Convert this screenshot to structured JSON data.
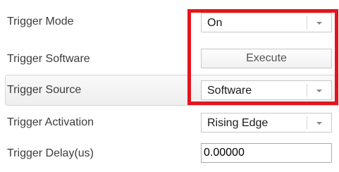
{
  "properties": [
    {
      "label": "Trigger Mode",
      "type": "dropdown",
      "value": "On"
    },
    {
      "label": "Trigger Software",
      "type": "button",
      "value": "Execute"
    },
    {
      "label": "Trigger Source",
      "type": "dropdown",
      "value": "Software"
    },
    {
      "label": "Trigger Activation",
      "type": "dropdown",
      "value": "Rising Edge"
    },
    {
      "label": "Trigger Delay(us)",
      "type": "input",
      "value": "0.00000"
    }
  ],
  "highlight_color": "#e3151c"
}
